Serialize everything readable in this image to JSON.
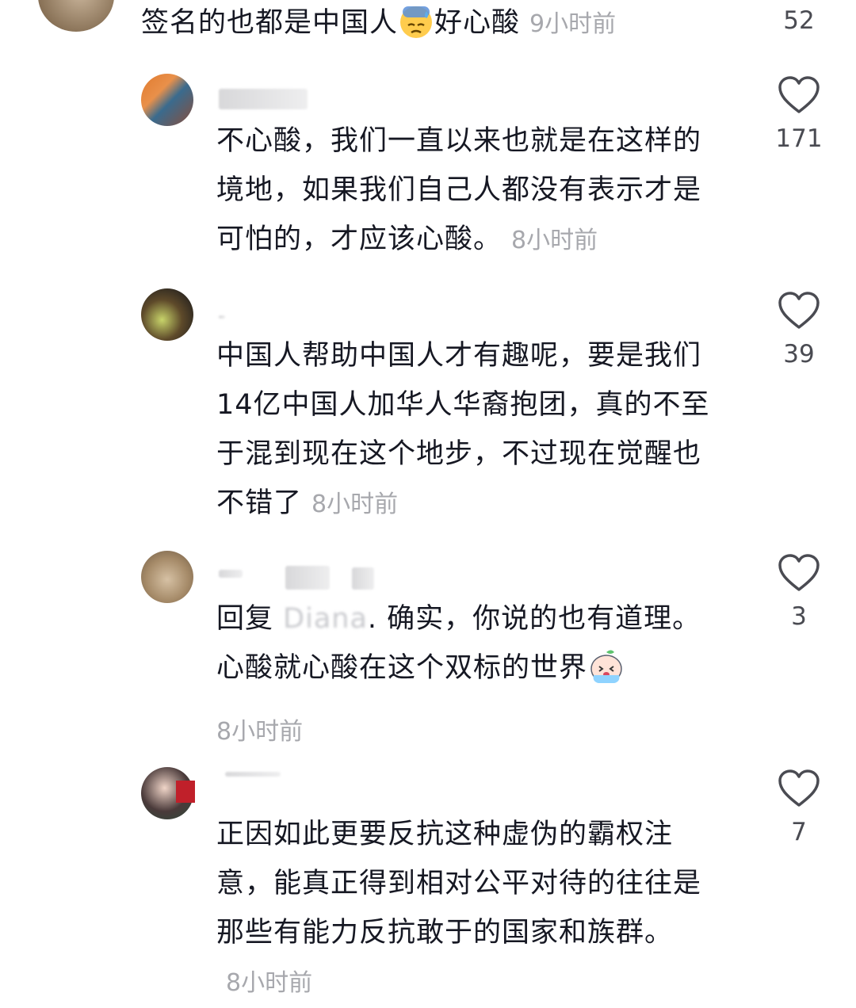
{
  "comments": [
    {
      "text": "签名的也都是中国人",
      "text_after_emoji": "好心酸",
      "emoji": "sweat-downcast-face",
      "time": "9小时前",
      "likes": "52"
    },
    {
      "text": "不心酸，我们一直以来也就是在这样的境地，如果我们自己人都没有表示才是可怕的，才应该心酸。",
      "time": "8小时前",
      "likes": "171"
    },
    {
      "text": "中国人帮助中国人才有趣呢，要是我们14亿中国人加华人华裔抱团，真的不至于混到现在这个地步，不过现在觉醒也不错了",
      "time": "8小时前",
      "likes": "39"
    },
    {
      "reply_prefix": "回复",
      "reply_target": "Diana",
      "text": ". 确实，你说的也有道理。心酸就心酸在这个双标的世界",
      "emoji": "crying-peach-face",
      "time": "8小时前",
      "likes": "3"
    },
    {
      "text": "正因如此更要反抗这种虚伪的霸权注意，能真正得到相对公平对待的往往是那些有能力反抗敢于的国家和族群。",
      "time": "8小时前",
      "likes": "7"
    }
  ],
  "colors": {
    "text": "#161823",
    "muted": "#a7a8ad",
    "count": "#4a4b52",
    "heart_stroke": "#4a4b52"
  }
}
